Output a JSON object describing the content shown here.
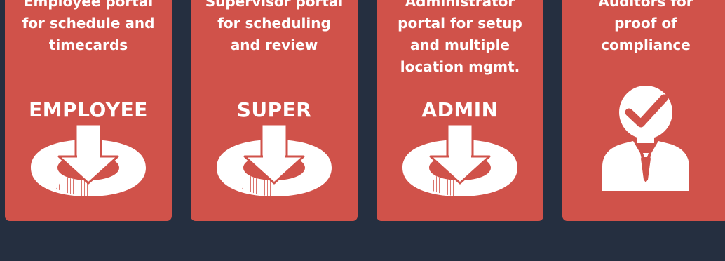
{
  "colors": {
    "background": "#252f40",
    "card": "#d0524a",
    "text": "#ffffff"
  },
  "cards": [
    {
      "description_lines": [
        "Employee portal",
        "for schedule and",
        "timecards"
      ],
      "title": "EMPLOYEE",
      "icon": "download-icon"
    },
    {
      "description_lines": [
        "Supervisor portal",
        "for scheduling",
        "and review"
      ],
      "title": "SUPER",
      "icon": "download-icon"
    },
    {
      "description_lines": [
        "Administrator",
        "portal for setup",
        "and multiple",
        "location mgmt."
      ],
      "title": "ADMIN",
      "icon": "download-icon"
    },
    {
      "description_lines": [
        "Auditors for",
        "proof of",
        "compliance"
      ],
      "title": "",
      "icon": "auditor-check-icon"
    }
  ]
}
